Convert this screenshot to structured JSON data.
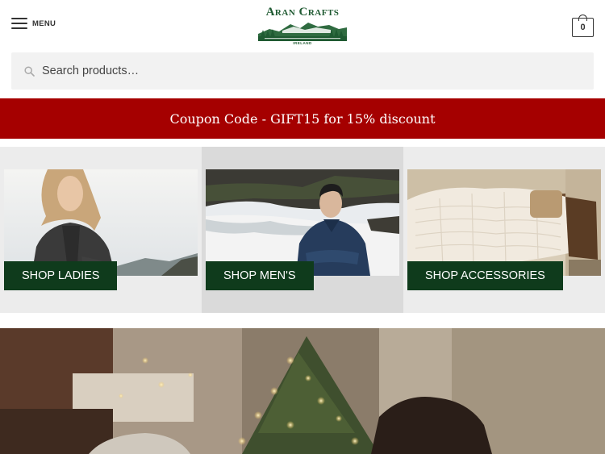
{
  "header": {
    "menu_label": "MENU",
    "logo_text": "Aran Crafts",
    "logo_subtext": "IRELAND",
    "cart_count": "0"
  },
  "search": {
    "placeholder": "Search products…"
  },
  "banner": {
    "text": "Coupon Code - GIFT15 for 15% discount",
    "color": "#a50000"
  },
  "categories": [
    {
      "label": "SHOP LADIES"
    },
    {
      "label": "SHOP MEN'S"
    },
    {
      "label": "SHOP ACCESSORIES"
    }
  ],
  "colors": {
    "brand_green": "#1f5a32",
    "button_green": "#0f3b1c",
    "coupon_red": "#a50000"
  },
  "icons": [
    "hamburger-icon",
    "search-icon",
    "shopping-bag-icon"
  ]
}
